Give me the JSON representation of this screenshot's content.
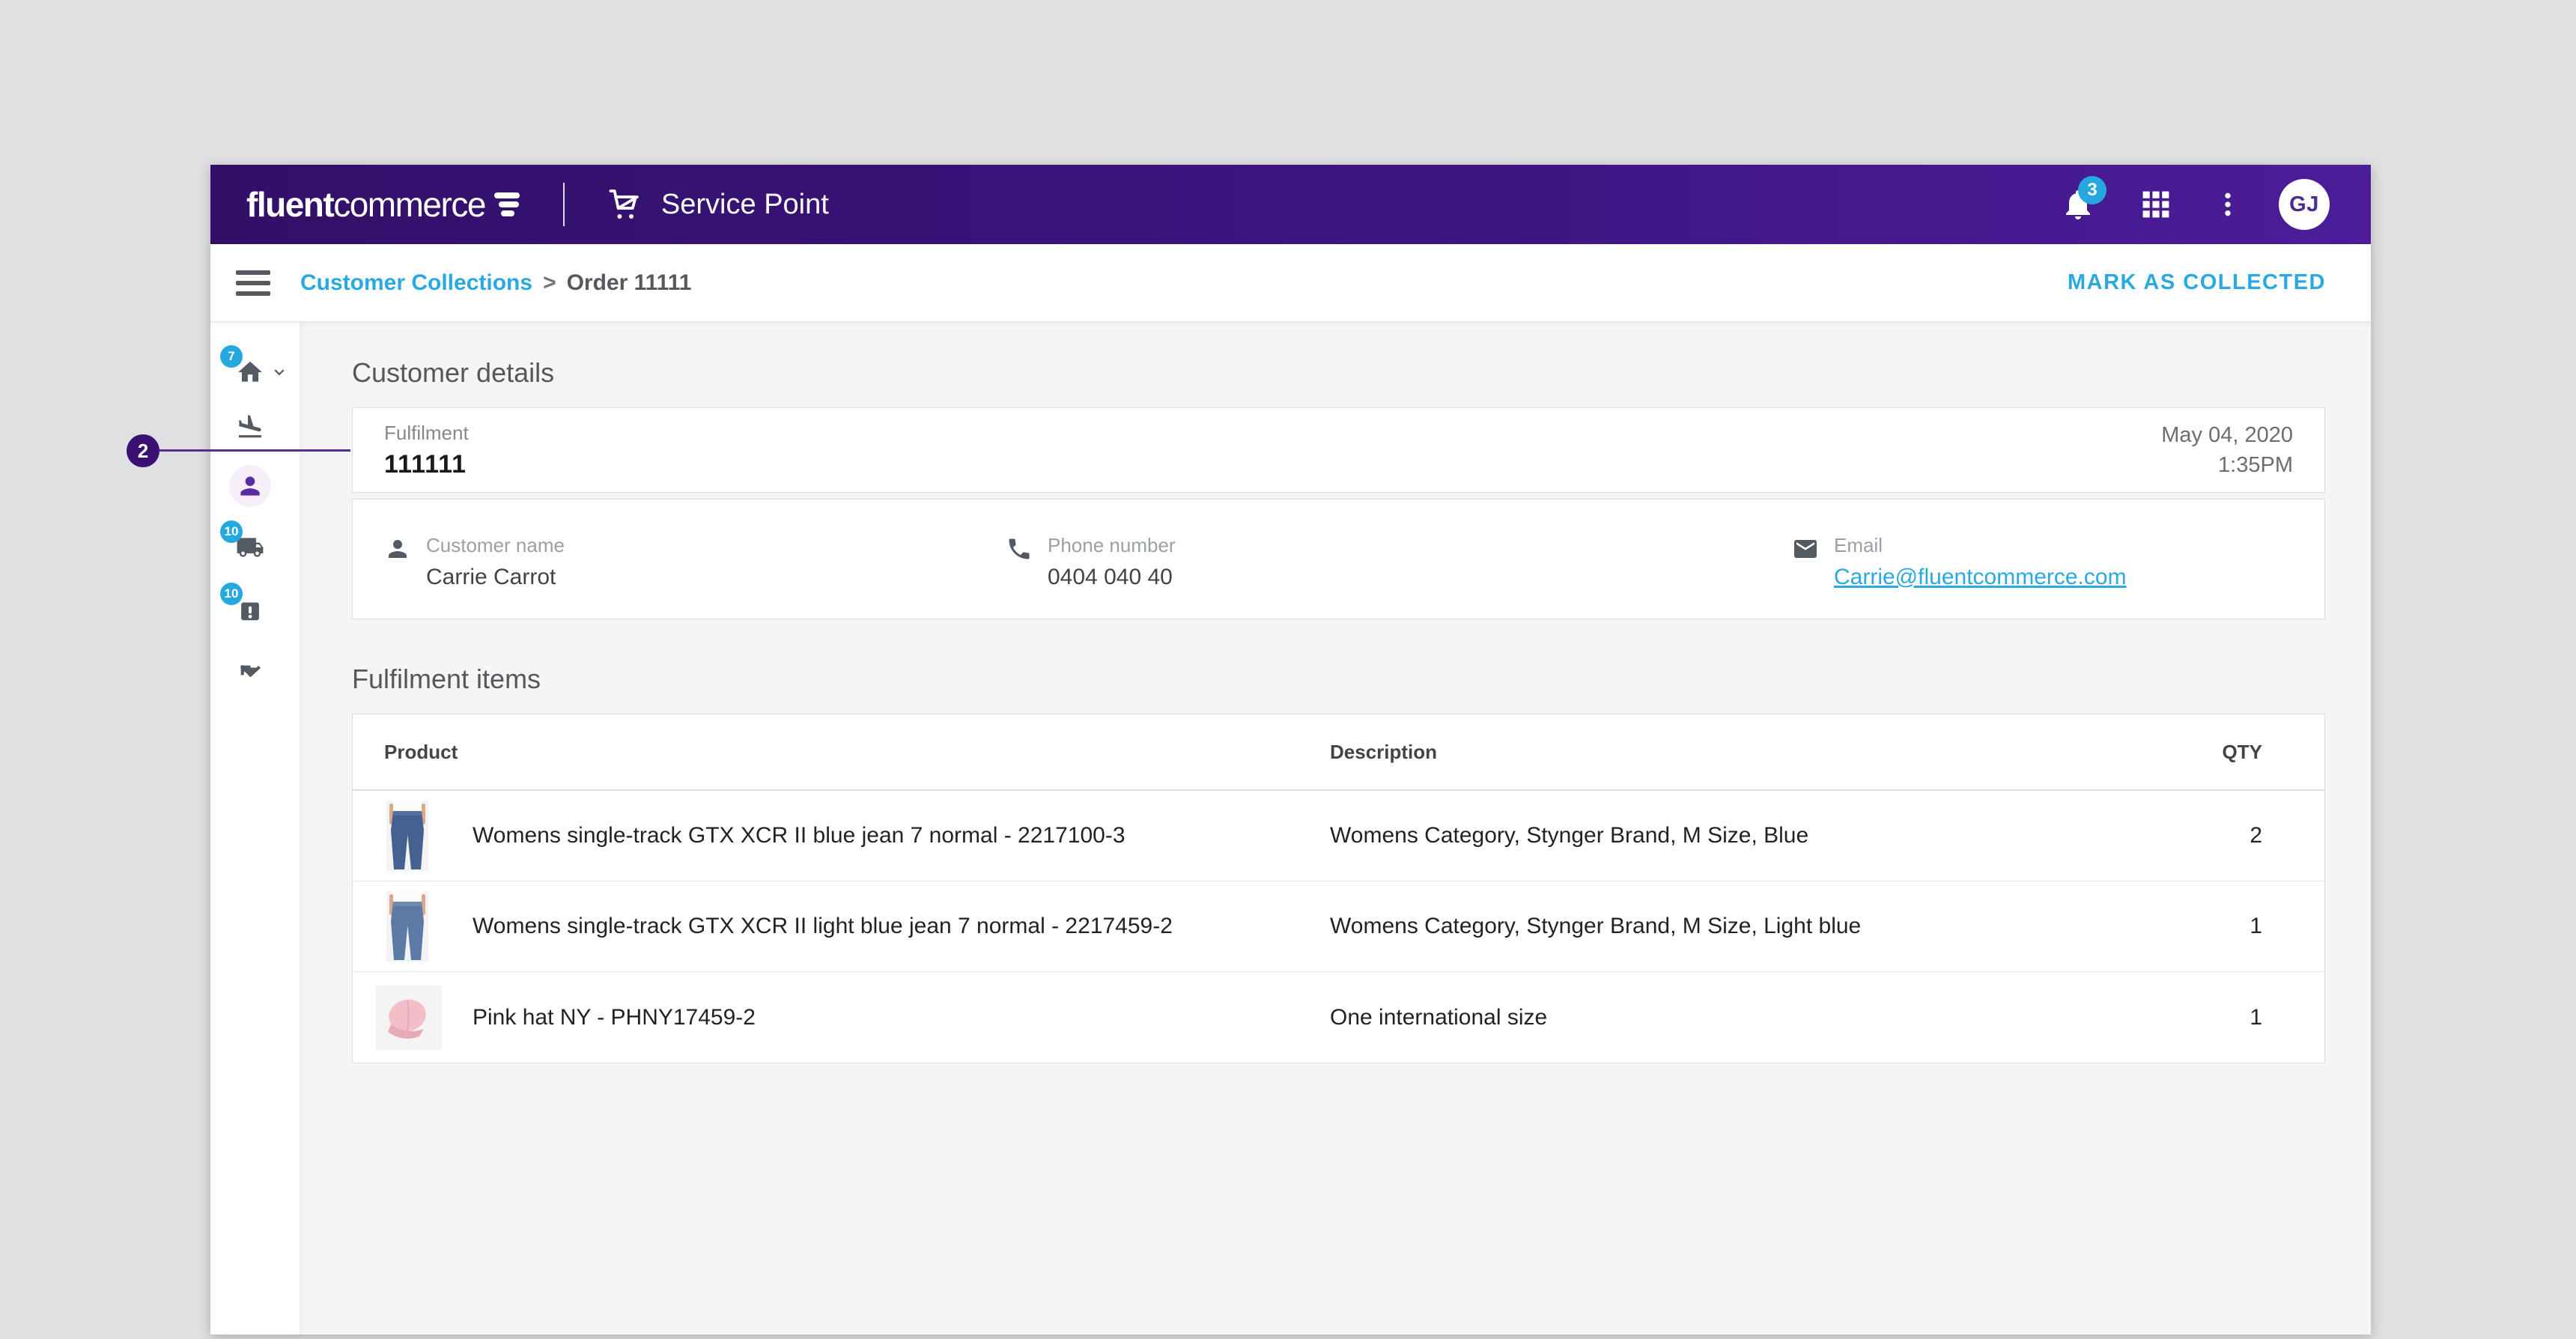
{
  "header": {
    "logo_fluent": "fluent",
    "logo_commerce": "commerce",
    "app_name": "Service Point",
    "notification_count": "3",
    "avatar_initials": "GJ"
  },
  "breadcrumb": {
    "parent": "Customer Collections",
    "separator": ">",
    "current": "Order 11111",
    "action_label": "MARK AS COLLECTED"
  },
  "sidebar": {
    "items": [
      {
        "icon": "home-icon",
        "badge": "7",
        "expandable": true
      },
      {
        "icon": "flight-land-icon"
      },
      {
        "icon": "person-icon",
        "active": true
      },
      {
        "icon": "truck-icon",
        "badge": "10"
      },
      {
        "icon": "package-alert-icon",
        "badge": "10"
      },
      {
        "icon": "collect-check-icon"
      }
    ]
  },
  "annotation": {
    "label": "2"
  },
  "customer_details": {
    "section_title": "Customer details",
    "fulfilment_label": "Fulfilment",
    "fulfilment_value": "111111",
    "date": "May 04, 2020",
    "time": "1:35PM",
    "fields": [
      {
        "icon": "person-icon",
        "label": "Customer name",
        "value": "Carrie Carrot"
      },
      {
        "icon": "phone-icon",
        "label": "Phone number",
        "value": "0404 040 40"
      },
      {
        "icon": "email-icon",
        "label": "Email",
        "value": "Carrie@fluentcommerce.com",
        "link": true
      }
    ]
  },
  "fulfilment_items": {
    "section_title": "Fulfilment items",
    "columns": [
      "Product",
      "Description",
      "QTY"
    ],
    "rows": [
      {
        "image": "blue-jeans",
        "product": "Womens single-track GTX XCR II blue jean 7 normal - 2217100-3",
        "description": "Womens Category, Stynger Brand, M Size, Blue",
        "qty": "2"
      },
      {
        "image": "light-blue-jeans",
        "product": "Womens single-track GTX XCR II light blue jean 7 normal - 2217459-2",
        "description": "Womens Category, Stynger Brand, M Size, Light blue",
        "qty": "1"
      },
      {
        "image": "pink-hat",
        "product": "Pink hat NY - PHNY17459-2",
        "description": "One international size",
        "qty": "1"
      }
    ]
  },
  "colors": {
    "accent_cyan": "#29a9e0",
    "badge_cyan": "#25a8de",
    "header_gradient_left": "#321068",
    "header_gradient_right": "#4b1d99",
    "annotation_purple": "#3a1173",
    "annotation_line": "#5b2d90",
    "active_nav_purple": "#5c2da2",
    "page_background": "#f5f5f6",
    "desktop_background": "#dfe0e1"
  }
}
